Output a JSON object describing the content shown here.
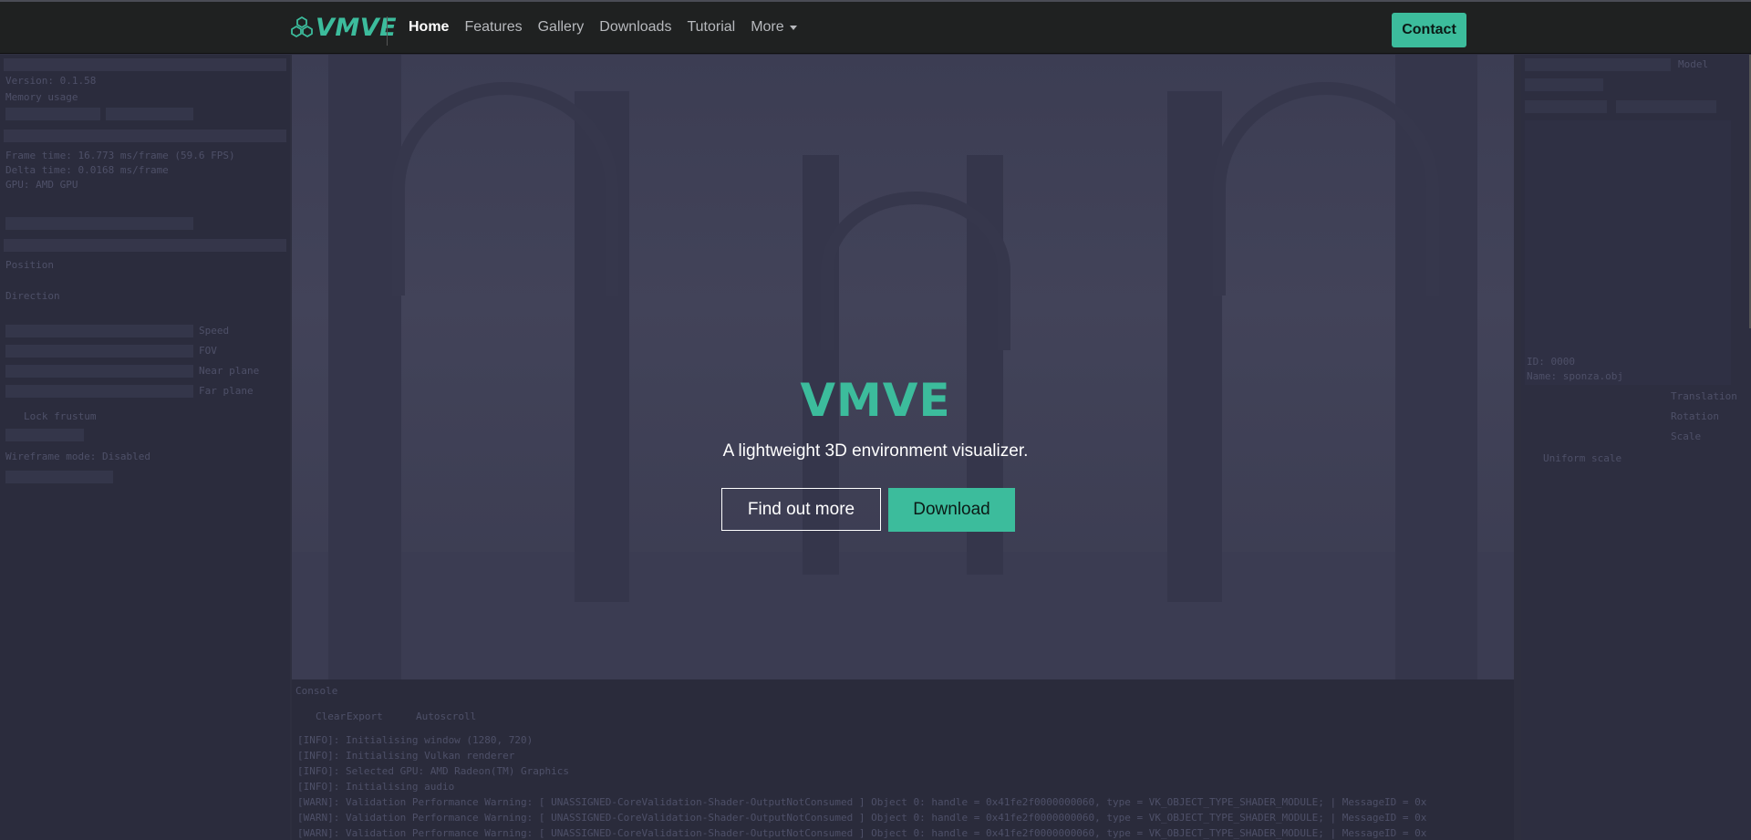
{
  "navbar": {
    "brand": "VMVE",
    "links": [
      {
        "label": "Home",
        "active": true
      },
      {
        "label": "Features"
      },
      {
        "label": "Gallery"
      },
      {
        "label": "Downloads"
      },
      {
        "label": "Tutorial"
      }
    ],
    "more_label": "More",
    "contact_label": "Contact"
  },
  "hero": {
    "title": "VMVE",
    "subtitle": "A lightweight 3D environment visualizer.",
    "find_out_more_label": "Find out more",
    "download_label": "Download"
  },
  "background_ui": {
    "left_panel": {
      "line1": "Version: 0.1.58",
      "line2": "Memory usage",
      "line3": "Frame time: 16.773 ms/frame (59.6 FPS)",
      "line4": "Delta time: 0.0168 ms/frame",
      "line5": "GPU: AMD GPU",
      "line6": "Position",
      "line7": "Direction",
      "line8": "Speed",
      "line9": "FOV",
      "line10": "Near plane",
      "line11": "Far plane",
      "line12": "Lock frustum",
      "line13": "Wireframe mode: Disabled"
    },
    "right_panel": {
      "line1": "Model",
      "line2": "ID: 0000",
      "line3": "Name: sponza.obj",
      "line4": "Translation",
      "line5": "Rotation",
      "line6": "Scale",
      "line7": "Uniform scale"
    },
    "console": {
      "title": "Console",
      "clear": "Clear",
      "export": "Export",
      "autoscroll": "Autoscroll",
      "lines": [
        "[INFO]: Initialising window (1280, 720)",
        "[INFO]: Initialising Vulkan renderer",
        "[INFO]: Selected GPU: AMD Radeon(TM) Graphics",
        "[INFO]: Initialising audio",
        "[WARN]: Validation Performance Warning: [ UNASSIGNED-CoreValidation-Shader-OutputNotConsumed ] Object 0: handle = 0x41fe2f0000000060, type = VK_OBJECT_TYPE_SHADER_MODULE; | MessageID = 0x",
        "[WARN]: Validation Performance Warning: [ UNASSIGNED-CoreValidation-Shader-OutputNotConsumed ] Object 0: handle = 0x41fe2f0000000060, type = VK_OBJECT_TYPE_SHADER_MODULE; | MessageID = 0x",
        "[WARN]: Validation Performance Warning: [ UNASSIGNED-CoreValidation-Shader-OutputNotConsumed ] Object 0: handle = 0x41fe2f0000000060, type = VK_OBJECT_TYPE_SHADER_MODULE; | MessageID = 0x"
      ]
    }
  },
  "colors": {
    "accent": "#3cbc9c",
    "navbar_bg": "#1f2121",
    "page_bg": "#2e2f3f"
  }
}
